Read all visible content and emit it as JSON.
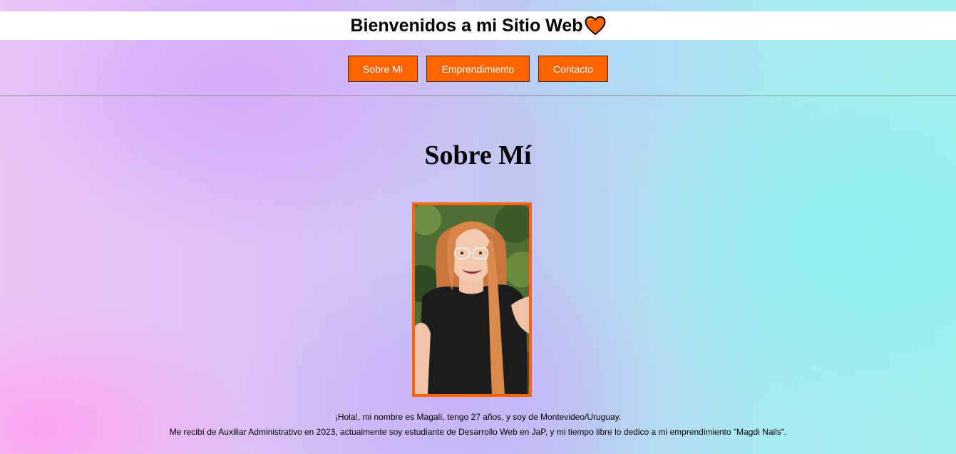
{
  "header": {
    "title": "Bienvenidos a mi Sitio Web",
    "title_icon": "heart-icon",
    "accent_color": "#ff6400"
  },
  "nav": {
    "items": [
      {
        "label": "Sobre Mi"
      },
      {
        "label": "Emprendimiento"
      },
      {
        "label": "Contacto"
      }
    ],
    "button_color": "#ff6400"
  },
  "about": {
    "title": "Sobre Mí",
    "photo_alt": "profile-photo",
    "line1": "¡Hola!, mi nombre es Magalí, tengo 27 años, y soy de Montevideo/Uruguay.",
    "line2": "Me recibí de Auxiliar Administrativo en 2023, actualmente soy estudiante de Desarrollo Web en JaP, y mi tiempo libre lo dedico a mi emprendimiento \"Magdi Nails\"."
  }
}
